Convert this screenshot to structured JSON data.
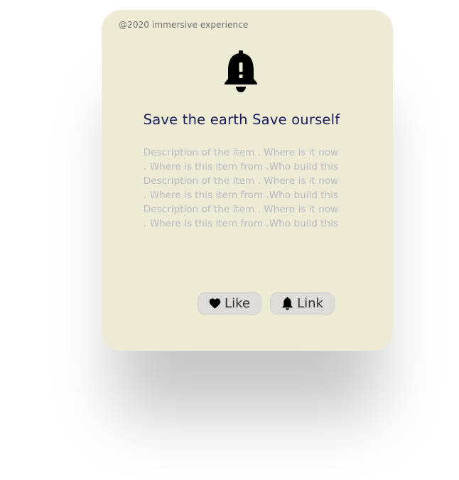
{
  "card": {
    "copyright": "@2020 immersive experience",
    "icon": "bell-alert-icon",
    "title": "Save the earth Save ourself",
    "description": "Description of the item . Where is it now . Where is this item from .Who build this Description of the item . Where is it now . Where is this item from .Who build this Description of the item . Where is it now . Where is this item from .Who build this",
    "background_color": "#eeebd5",
    "title_color": "#141a5c"
  },
  "actions": {
    "like": {
      "label": "Like",
      "icon": "heart-icon"
    },
    "link": {
      "label": "Link",
      "icon": "bell-icon"
    }
  }
}
